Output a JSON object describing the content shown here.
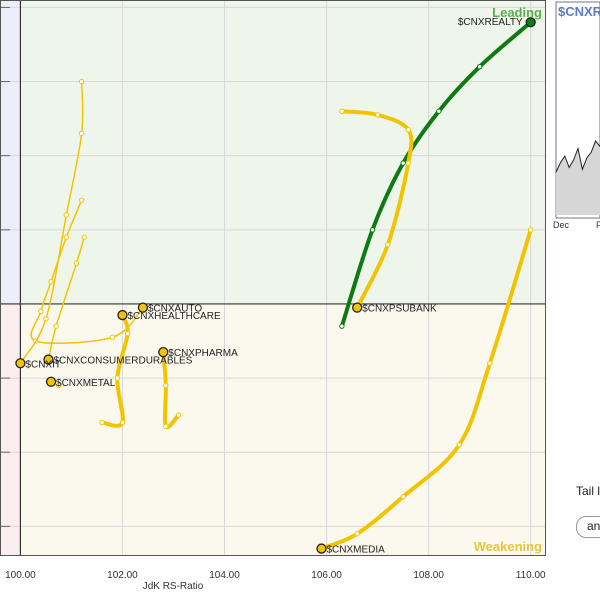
{
  "chart_data": {
    "type": "scatter",
    "xlabel": "JdK RS-Ratio",
    "xlim": [
      99.6,
      110.3
    ],
    "ylim": [
      96.6,
      104.1
    ],
    "x_ticks": [
      "100.00",
      "102.00",
      "104.00",
      "106.00",
      "108.00",
      "110.00"
    ],
    "center": [
      100,
      100
    ],
    "quadrants": {
      "leading": "Leading",
      "weakening": "Weakening"
    },
    "colors": {
      "leading_bg": "#eef6ec",
      "weakening_bg": "#fbf8ee",
      "lagging_bg": "#faeef0",
      "improving_bg": "#eeeefa",
      "leading_text": "#57b14a",
      "weakening_text": "#e8c440",
      "tail_yellow": "#f2c400",
      "tail_green": "#0d7a12",
      "grid": "#d8d8d8"
    },
    "series": [
      {
        "name": "$CNXREALTY",
        "color": "#0d7a12",
        "head": "#0d7a12",
        "width": 4,
        "points": [
          [
            106.3,
            99.7
          ],
          [
            106.9,
            101.0
          ],
          [
            107.5,
            101.9
          ],
          [
            108.2,
            102.6
          ],
          [
            109.0,
            103.2
          ],
          [
            110.0,
            103.8
          ]
        ]
      },
      {
        "name": "$CNXMEDIA",
        "color": "#f2c400",
        "head": "#f2c400",
        "width": 4,
        "points": [
          [
            110.0,
            101.0
          ],
          [
            109.2,
            99.2
          ],
          [
            108.6,
            98.1
          ],
          [
            107.5,
            97.4
          ],
          [
            106.6,
            96.9
          ],
          [
            105.9,
            96.7
          ]
        ]
      },
      {
        "name": "$CNXPSUBANK",
        "color": "#f2c400",
        "head": "#f2c400",
        "width": 4,
        "points": [
          [
            106.3,
            102.6
          ],
          [
            107.0,
            102.55
          ],
          [
            107.6,
            102.35
          ],
          [
            107.6,
            101.9
          ],
          [
            107.2,
            100.8
          ],
          [
            106.6,
            99.95
          ]
        ]
      },
      {
        "name": "$CNXAUTO",
        "color": "#f2c400",
        "head": "#f2c400",
        "width": 1.5,
        "points": [
          [
            101.2,
            101.4
          ],
          [
            100.9,
            100.9
          ],
          [
            100.6,
            100.3
          ],
          [
            100.4,
            99.9
          ],
          [
            100.3,
            99.5
          ],
          [
            101.8,
            99.55
          ],
          [
            102.4,
            99.95
          ]
        ]
      },
      {
        "name": "$CNXHEALTHCARE",
        "color": "#f2c400",
        "head": "#f2c400",
        "width": 4,
        "points": [
          [
            101.6,
            98.4
          ],
          [
            102.0,
            98.4
          ],
          [
            101.9,
            99.0
          ],
          [
            102.1,
            99.6
          ],
          [
            102.0,
            99.85
          ]
        ]
      },
      {
        "name": "$CNXPHARMA",
        "color": "#f2c400",
        "head": "#f2c400",
        "width": 4,
        "points": [
          [
            103.1,
            98.5
          ],
          [
            102.85,
            98.35
          ],
          [
            102.85,
            98.9
          ],
          [
            102.8,
            99.35
          ]
        ]
      },
      {
        "name": "$CNXCONSUMERDURABLES",
        "color": "#f2c400",
        "head": "#f2c400",
        "width": 1.5,
        "points": [
          [
            101.25,
            100.9
          ],
          [
            101.1,
            100.55
          ],
          [
            100.7,
            99.7
          ],
          [
            100.55,
            99.25
          ]
        ]
      },
      {
        "name": "$CNXMETAL",
        "color": "#f2c400",
        "head": "#f2c400",
        "width": 1.5,
        "points": [
          [
            100.75,
            98.9
          ],
          [
            100.6,
            98.95
          ]
        ]
      },
      {
        "name": "$CNXIT",
        "color": "#f2c400",
        "head": "#f2c400",
        "width": 1.5,
        "points": [
          [
            101.2,
            103.0
          ],
          [
            101.2,
            102.3
          ],
          [
            100.9,
            101.2
          ],
          [
            100.5,
            99.8
          ],
          [
            100.0,
            99.2
          ]
        ]
      }
    ]
  },
  "mini_chart": {
    "title": "$CNXRE",
    "x_ticks": [
      "Dec",
      "F"
    ],
    "line": [
      0.45,
      0.55,
      0.62,
      0.5,
      0.58,
      0.7,
      0.48,
      0.6,
      0.66,
      0.78,
      0.72
    ]
  },
  "controls": {
    "tail_label": "Tail l",
    "animate_label": "animate"
  }
}
